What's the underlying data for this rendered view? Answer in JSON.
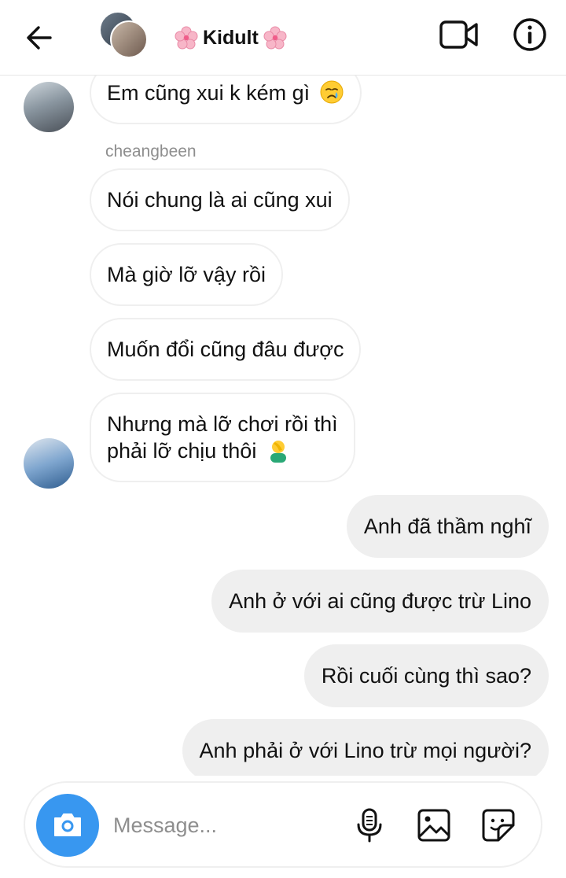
{
  "header": {
    "title": "Kidult",
    "title_decoration_icon": "cherry-blossom-emoji",
    "back_icon": "arrow-left-icon",
    "video_icon": "video-camera-icon",
    "info_icon": "info-icon"
  },
  "messages": [
    {
      "side": "in",
      "text": "Em cũng xui k kém gì",
      "emoji": "crying-face-emoji"
    },
    {
      "side": "in",
      "sender": "cheangbeen",
      "text": "Nói chung là ai cũng xui"
    },
    {
      "side": "in",
      "text": "Mà giờ lỡ vậy rồi"
    },
    {
      "side": "in",
      "text": "Muốn đổi cũng đâu được"
    },
    {
      "side": "in",
      "text_line1": "Nhưng mà lỡ chơi rồi thì",
      "text_line2": "phải lỡ chịu thôi",
      "emoji": "facepalm-emoji"
    },
    {
      "side": "out",
      "text": "Anh đã thầm nghĩ"
    },
    {
      "side": "out",
      "text": "Anh ở với ai cũng được trừ Lino"
    },
    {
      "side": "out",
      "text": "Rồi cuối cùng thì sao?"
    },
    {
      "side": "out",
      "text": "Anh phải ở với Lino trừ mọi người?"
    }
  ],
  "composer": {
    "placeholder": "Message...",
    "camera_icon": "camera-icon",
    "mic_icon": "microphone-icon",
    "gallery_icon": "image-icon",
    "sticker_icon": "sticker-icon"
  },
  "colors": {
    "accent": "#3897f0",
    "incoming_border": "#efefef",
    "outgoing_bg": "#efefef",
    "muted_text": "#8e8e8e"
  }
}
